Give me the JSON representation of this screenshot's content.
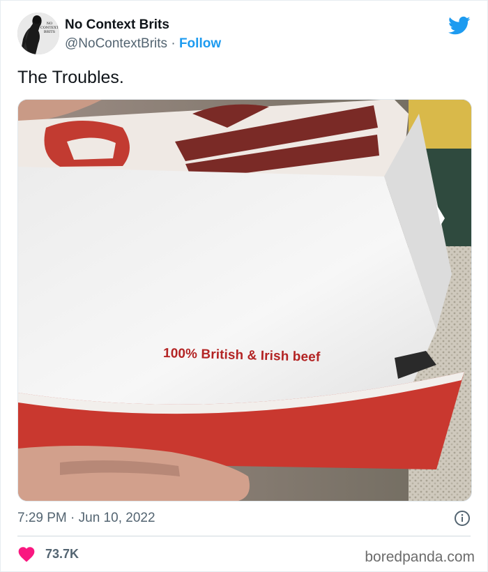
{
  "tweet": {
    "author": {
      "display_name": "No Context Brits",
      "handle": "@NoContextBrits",
      "separator": "·",
      "follow_label": "Follow",
      "avatar_text": [
        "NO",
        "CONTEXT",
        "BRITS"
      ]
    },
    "text": "The Troubles.",
    "media": {
      "box_text": "100% British & Irish beef"
    },
    "timestamp": "7:29 PM · Jun 10, 2022",
    "likes": "73.7K"
  },
  "watermark": "boredpanda.com",
  "icons": {
    "brand": "twitter-bird-icon",
    "info": "info-icon",
    "like": "heart-icon"
  },
  "colors": {
    "accent": "#1d9bf0",
    "heart": "#f91880",
    "text_secondary": "#536471",
    "box_red": "#c9382f"
  }
}
